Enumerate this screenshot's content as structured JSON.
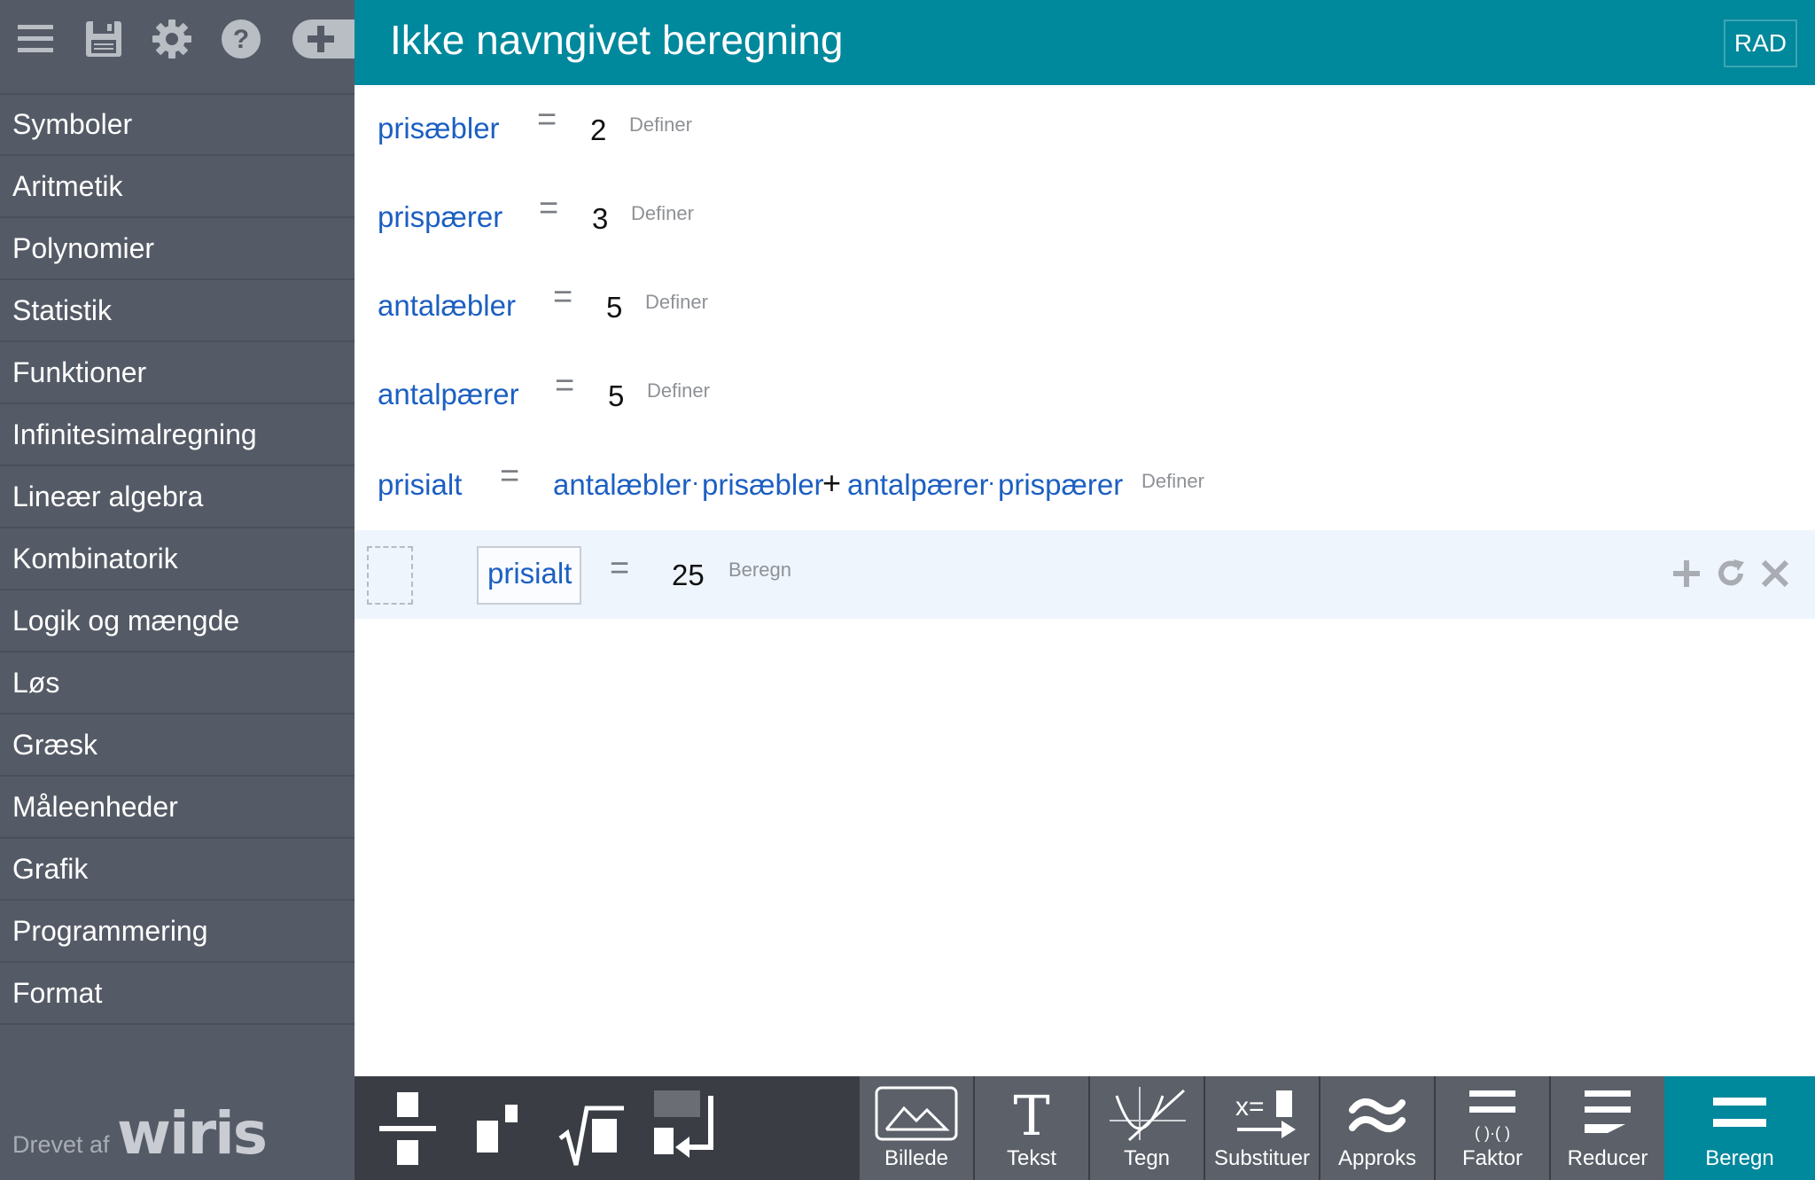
{
  "sidebar": {
    "toolbar_icons": [
      "menu-icon",
      "save-icon",
      "gear-icon",
      "help-icon",
      "add-tab-icon"
    ],
    "items": [
      {
        "label": "Symboler"
      },
      {
        "label": "Aritmetik"
      },
      {
        "label": "Polynomier"
      },
      {
        "label": "Statistik"
      },
      {
        "label": "Funktioner"
      },
      {
        "label": "Infinitesimalregning"
      },
      {
        "label": "Lineær algebra"
      },
      {
        "label": "Kombinatorik"
      },
      {
        "label": "Logik og mængde"
      },
      {
        "label": "Løs"
      },
      {
        "label": "Græsk"
      },
      {
        "label": "Måleenheder"
      },
      {
        "label": "Grafik"
      },
      {
        "label": "Programmering"
      },
      {
        "label": "Format"
      }
    ],
    "powered_by": "Drevet af",
    "logo_text": "wiris"
  },
  "header": {
    "title": "Ikke navngivet beregning",
    "angle_mode": "RAD"
  },
  "worksheet": {
    "rows": [
      {
        "lhs": "prisæbler",
        "eq": "=",
        "rhs": "2",
        "action": "Definer"
      },
      {
        "lhs": "prispærer",
        "eq": "=",
        "rhs": "3",
        "action": "Definer"
      },
      {
        "lhs": "antalæbler",
        "eq": "=",
        "rhs": "5",
        "action": "Definer"
      },
      {
        "lhs": "antalpærer",
        "eq": "=",
        "rhs": "5",
        "action": "Definer"
      }
    ],
    "formula_row": {
      "lhs": "prisialt",
      "eq": "=",
      "t1": "antalæbler",
      "dot1": "·",
      "t2": "prisæbler",
      "plus": "+",
      "t3": "antalpærer",
      "dot2": "·",
      "t4": "prispærer",
      "action": "Definer"
    },
    "calc_row": {
      "input": "prisialt",
      "eq": "=",
      "result": "25",
      "action": "Beregn"
    }
  },
  "bottom_toolbar": {
    "buttons": [
      {
        "label": "Billede",
        "icon": "image-icon"
      },
      {
        "label": "Tekst",
        "icon": "text-icon"
      },
      {
        "label": "Tegn",
        "icon": "plot-icon"
      },
      {
        "label": "Substituer",
        "icon": "substitute-icon"
      },
      {
        "label": "Approks",
        "icon": "approx-icon"
      },
      {
        "label": "Faktor",
        "icon": "factor-icon"
      },
      {
        "label": "Reducer",
        "icon": "reduce-icon"
      },
      {
        "label": "Beregn",
        "icon": "calculate-icon"
      }
    ],
    "text_glyph": "T",
    "substitute_glyph": "x="
  },
  "colors": {
    "sidebar_bg": "#555b66",
    "header_bg": "#00889c",
    "variable_blue": "#1c5fc2",
    "calc_row_bg": "#eef5fc",
    "toolbar_bg": "#3a3e44"
  }
}
